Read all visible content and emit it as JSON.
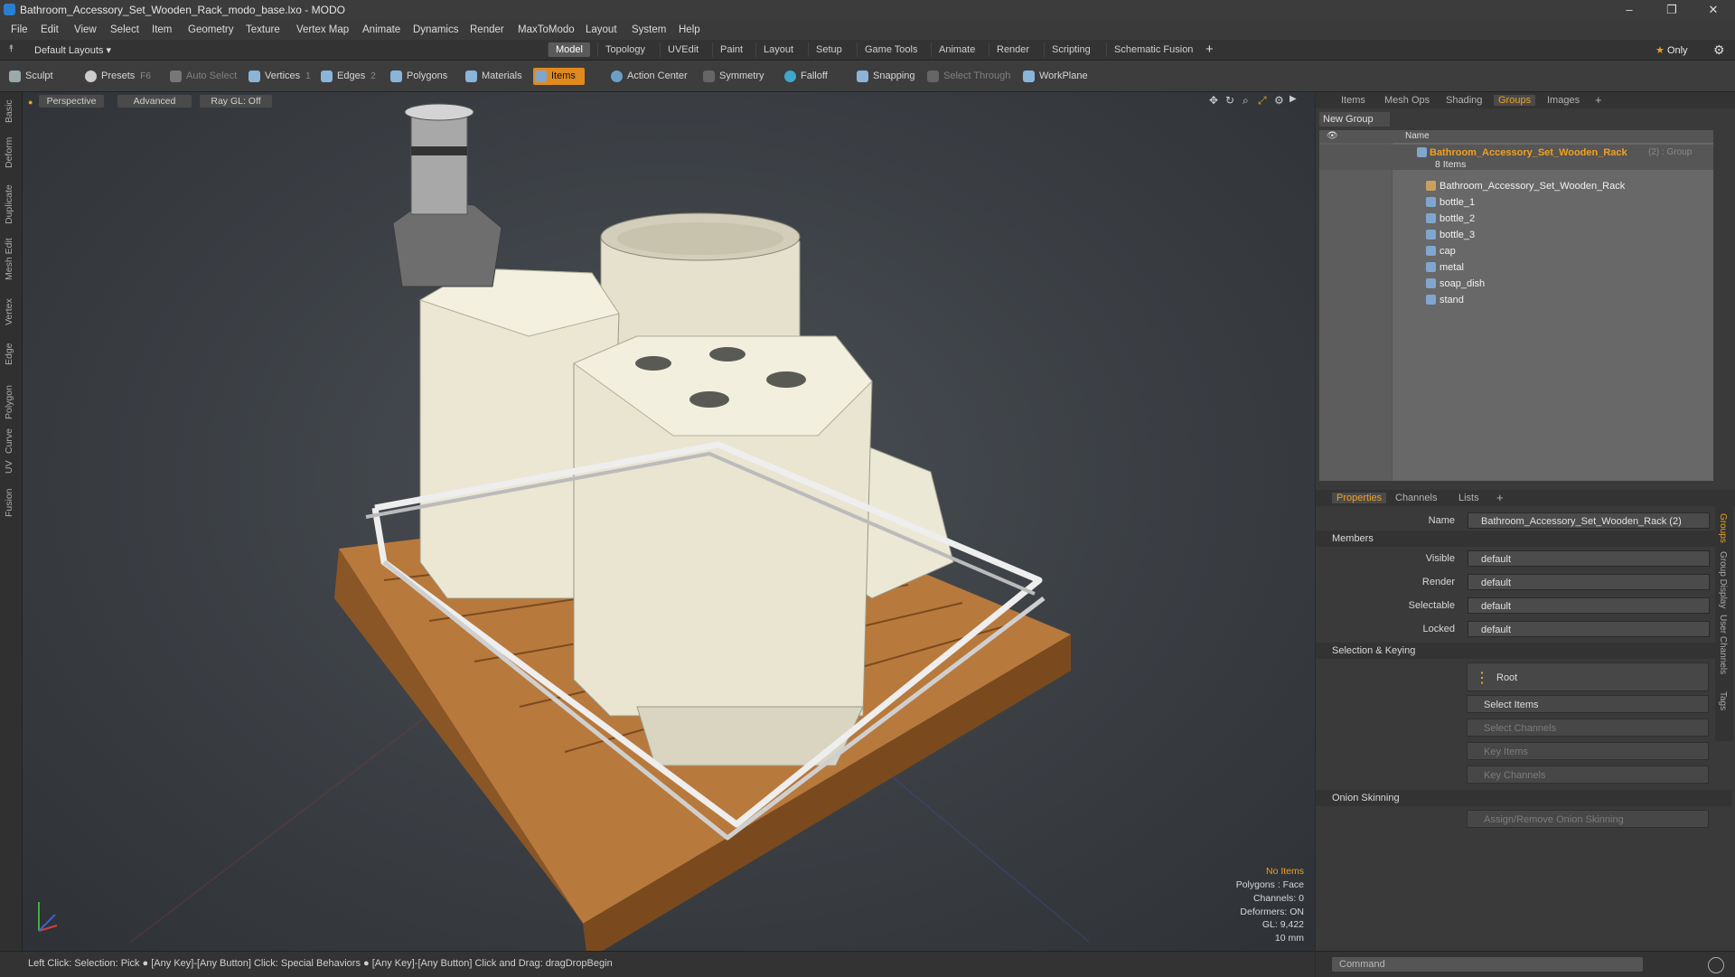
{
  "window": {
    "title": "Bathroom_Accessory_Set_Wooden_Rack_modo_base.lxo - MODO",
    "controls": [
      "–",
      "❐",
      "✕"
    ]
  },
  "menu": [
    "File",
    "Edit",
    "View",
    "Select",
    "Item",
    "Geometry",
    "Texture",
    "Vertex Map",
    "Animate",
    "Dynamics",
    "Render",
    "MaxToModo",
    "Layout",
    "System",
    "Help"
  ],
  "layout_bar": {
    "layouts_label": "Default Layouts",
    "tabs": [
      "Model",
      "Topology",
      "UVEdit",
      "Paint",
      "Layout",
      "Setup",
      "Game Tools",
      "Animate",
      "Render",
      "Scripting",
      "Schematic Fusion"
    ],
    "active_tab": "Model",
    "add": "+",
    "only_label": "Only"
  },
  "toolbar": {
    "sculpt": "Sculpt",
    "presets": "Presets",
    "presets_key": "F6",
    "auto_select": "Auto Select",
    "vertices": "Vertices",
    "vertices_count": "1",
    "edges": "Edges",
    "edges_count": "2",
    "polygons": "Polygons",
    "materials": "Materials",
    "items": "Items",
    "action_center": "Action Center",
    "symmetry": "Symmetry",
    "falloff": "Falloff",
    "snapping": "Snapping",
    "select_through": "Select Through",
    "workplane": "WorkPlane"
  },
  "left_tabs": [
    "Basic",
    "Deform",
    "Duplicate",
    "Mesh Edit",
    "Vertex",
    "Edge",
    "Polygon",
    "Curve",
    "UV",
    "Fusion"
  ],
  "viewport": {
    "perspective": "Perspective",
    "advanced": "Advanced",
    "raygl": "Ray GL: Off",
    "stats": {
      "no_items": "No Items",
      "polygons": "Polygons : Face",
      "channels": "Channels: 0",
      "deformers": "Deformers: ON",
      "gl": "GL: 9,422",
      "scale": "10 mm"
    }
  },
  "status_text": "Left Click: Selection: Pick ● [Any Key]-[Any Button] Click: Special Behaviors ● [Any Key]-[Any Button] Click and Drag: dragDropBegin",
  "right_panel": {
    "top_tabs": [
      "Items",
      "Mesh Ops",
      "Shading",
      "Groups",
      "Images"
    ],
    "active_top_tab": "Groups",
    "new_group": "New Group",
    "name_header": "Name",
    "group": {
      "name": "Bathroom_Accessory_Set_Wooden_Rack",
      "suffix": "(2) : Group",
      "count": "8 Items"
    },
    "items": [
      "Bathroom_Accessory_Set_Wooden_Rack",
      "bottle_1",
      "bottle_2",
      "bottle_3",
      "cap",
      "metal",
      "soap_dish",
      "stand"
    ],
    "bottom_tabs": [
      "Properties",
      "Channels",
      "Lists"
    ],
    "active_bottom_tab": "Properties",
    "side_tabs": [
      "Groups",
      "Group Display",
      "User Channels",
      "Tags"
    ],
    "props": {
      "name_label": "Name",
      "name_value": "Bathroom_Accessory_Set_Wooden_Rack (2)",
      "members": "Members",
      "visible_label": "Visible",
      "render_label": "Render",
      "selectable_label": "Selectable",
      "locked_label": "Locked",
      "default_value": "default",
      "selection_keying": "Selection & Keying",
      "root": "Root",
      "select_items": "Select Items",
      "select_channels": "Select Channels",
      "key_items": "Key Items",
      "key_channels": "Key Channels",
      "onion_skinning": "Onion Skinning",
      "assign_onion": "Assign/Remove Onion Skinning"
    },
    "command_placeholder": "Command"
  },
  "colors": {
    "accent": "#f0a020",
    "items_active": "#e08a1e",
    "group_selected": "#f0a020"
  }
}
